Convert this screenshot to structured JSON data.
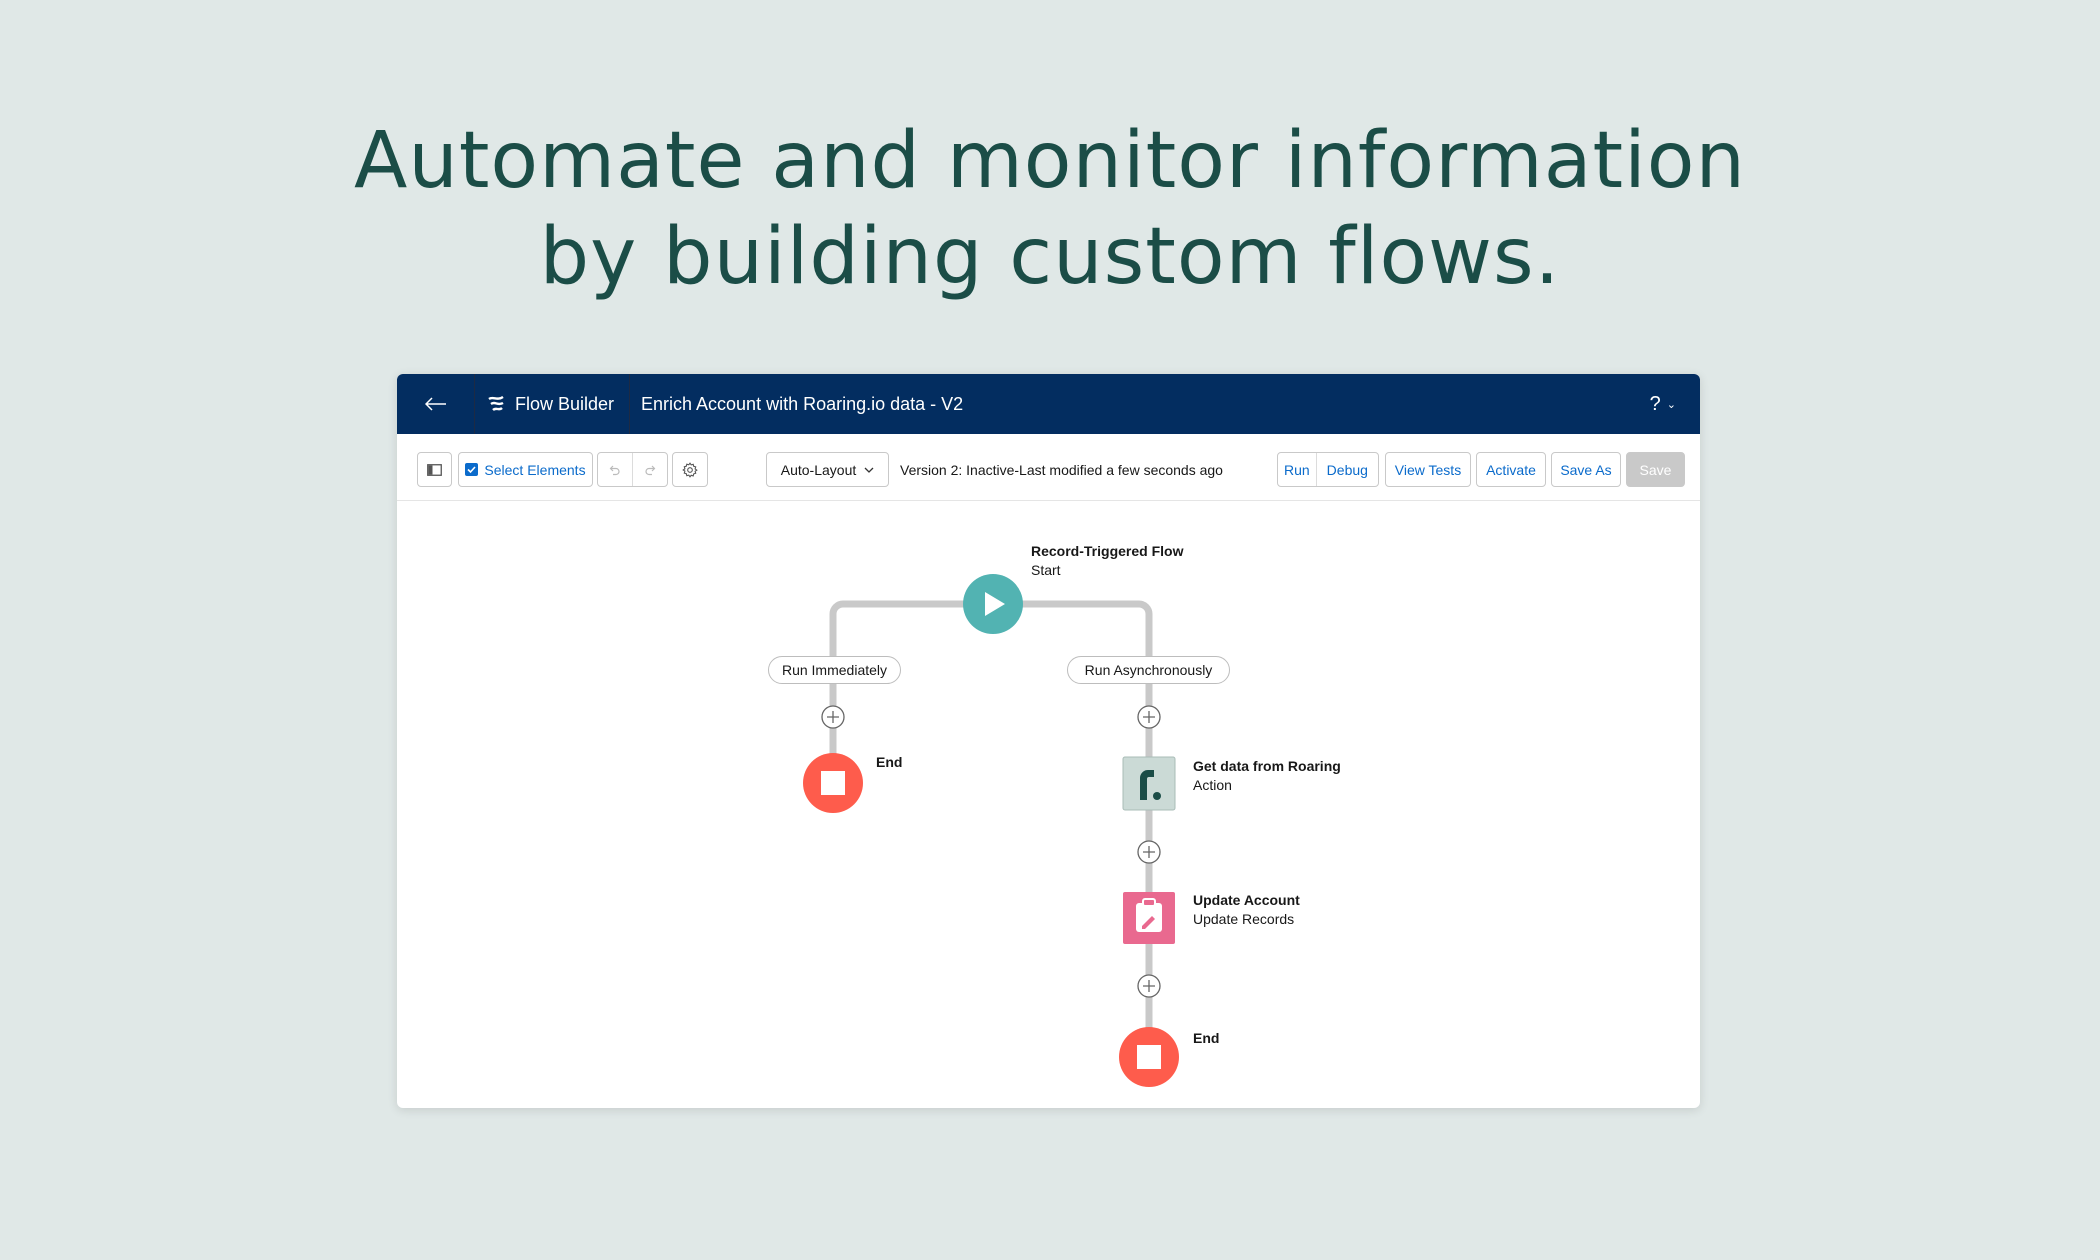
{
  "hero": {
    "line1": "Automate and monitor information",
    "line2": "by building custom flows."
  },
  "topbar": {
    "back_icon": "arrow-left-icon",
    "app_icon": "flow-icon",
    "app_name": "Flow Builder",
    "flow_title": "Enrich Account with Roaring.io data - V2",
    "help_label": "?",
    "help_chevron": "⌄"
  },
  "toolbar": {
    "panel_toggle_icon": "panel-toggle-icon",
    "select_elements_label": "Select Elements",
    "undo_icon": "undo-icon",
    "redo_icon": "redo-icon",
    "settings_icon": "gear-icon",
    "layout_select": "Auto-Layout",
    "version_status": "Version 2: Inactive-Last modified a few seconds ago",
    "run_label": "Run",
    "debug_label": "Debug",
    "view_tests_label": "View Tests",
    "activate_label": "Activate",
    "save_as_label": "Save As",
    "save_label": "Save"
  },
  "flow": {
    "start": {
      "title": "Record-Triggered Flow",
      "subtitle": "Start",
      "color": "#52b3b2"
    },
    "branches": [
      {
        "label": "Run Immediately",
        "end": {
          "title": "End"
        }
      },
      {
        "label": "Run Asynchronously",
        "steps": [
          {
            "title": "Get data from Roaring",
            "subtitle": "Action",
            "color": "#cbdad6"
          },
          {
            "title": "Update Account",
            "subtitle": "Update Records",
            "color": "#e9698f"
          }
        ],
        "end": {
          "title": "End"
        }
      }
    ],
    "end_color": "#fe5c4c",
    "connector_color": "#c9c9c9"
  },
  "colors": {
    "background": "#e0e8e7",
    "hero_text": "#1b4d47",
    "header": "#032d60",
    "link": "#0b6bcb"
  }
}
